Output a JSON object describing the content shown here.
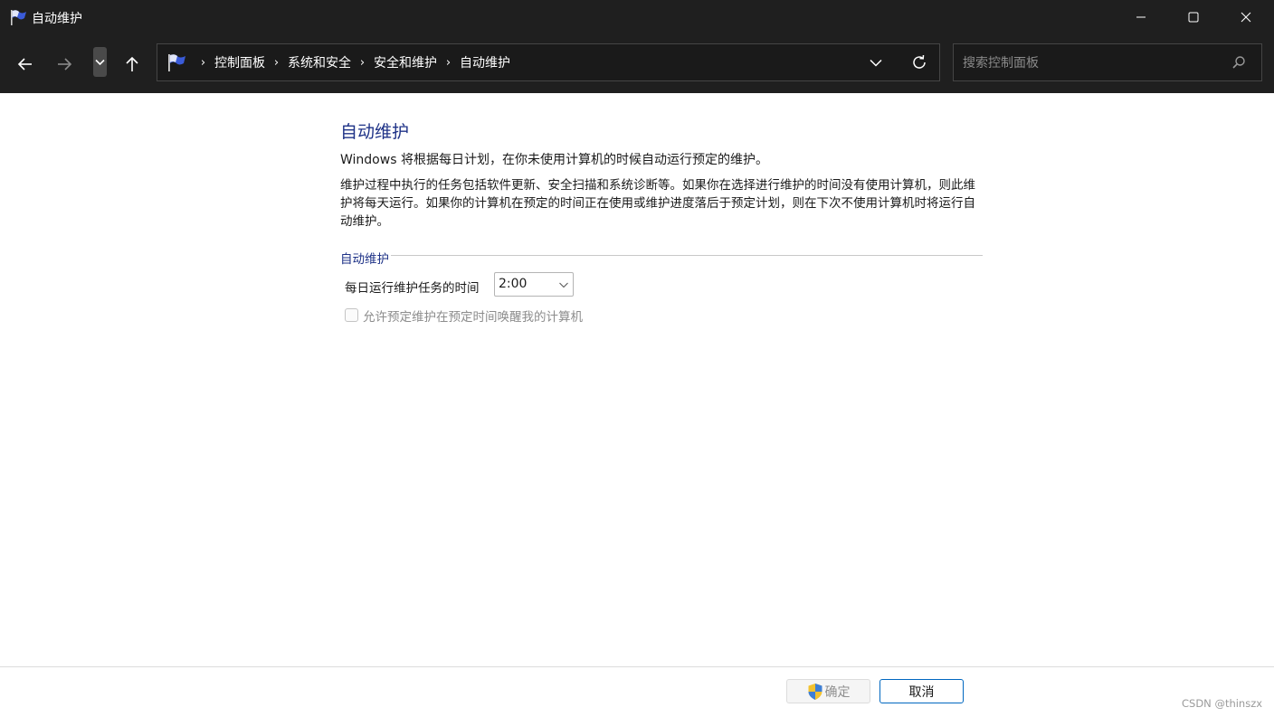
{
  "window": {
    "title": "自动维护",
    "app_icon": "control-panel-flag-icon",
    "controls": [
      "minimize-icon",
      "maximize-icon",
      "close-icon"
    ]
  },
  "nav": {
    "back_icon": "arrow-left-icon",
    "forward_icon": "arrow-right-icon",
    "recent_icon": "chevron-down-icon",
    "up_icon": "arrow-up-icon"
  },
  "address": {
    "icon": "control-panel-flag-icon",
    "breadcrumbs": [
      "控制面板",
      "系统和安全",
      "安全和维护",
      "自动维护"
    ],
    "separator": "›",
    "dropdown_icon": "chevron-down-icon",
    "refresh_icon": "refresh-icon"
  },
  "search": {
    "placeholder": "搜索控制面板",
    "value": "",
    "icon": "search-icon"
  },
  "main": {
    "title": "自动维护",
    "intro": "Windows 将根据每日计划，在你未使用计算机的时候自动运行预定的维护。",
    "description": "维护过程中执行的任务包括软件更新、安全扫描和系统诊断等。如果你在选择进行维护的时间没有使用计算机，则此维护将每天运行。如果你的计算机在预定的时间正在使用或维护进度落后于预定计划，则在下次不使用计算机时将运行自动维护。",
    "section_title": "自动维护",
    "time_label": "每日运行维护任务的时间",
    "time_value": "2:00",
    "wake_label": "允许预定维护在预定时间唤醒我的计算机",
    "wake_checked": false
  },
  "footer": {
    "ok_label": "确定",
    "cancel_label": "取消",
    "ok_icon": "uac-shield-icon",
    "watermark": "CSDN @thinszx"
  },
  "colors": {
    "titlebar_bg": "#1f1f1f",
    "heading_blue": "#1e3287",
    "accent": "#0067c0"
  }
}
